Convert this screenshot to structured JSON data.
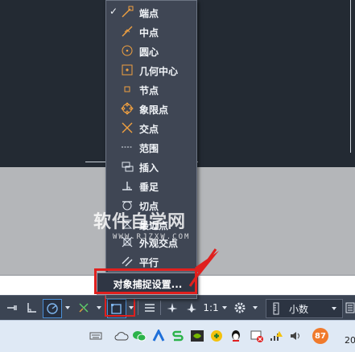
{
  "snap_menu": {
    "items": [
      {
        "label": "端点",
        "icon": "endpoint-icon",
        "checked": true
      },
      {
        "label": "中点",
        "icon": "midpoint-icon",
        "checked": false
      },
      {
        "label": "圆心",
        "icon": "center-icon",
        "checked": false
      },
      {
        "label": "几何中心",
        "icon": "geometric-center-icon",
        "checked": false
      },
      {
        "label": "节点",
        "icon": "node-icon",
        "checked": false
      },
      {
        "label": "象限点",
        "icon": "quadrant-icon",
        "checked": false
      },
      {
        "label": "交点",
        "icon": "intersection-icon",
        "checked": false
      },
      {
        "label": "范围",
        "icon": "extension-icon",
        "checked": false
      },
      {
        "label": "插入",
        "icon": "insertion-icon",
        "checked": false
      },
      {
        "label": "垂足",
        "icon": "perpendicular-icon",
        "checked": false
      },
      {
        "label": "切点",
        "icon": "tangent-icon",
        "checked": false
      },
      {
        "label": "最近点",
        "icon": "nearest-icon",
        "checked": false
      },
      {
        "label": "外观交点",
        "icon": "apparent-intersection-icon",
        "checked": false
      },
      {
        "label": "平行",
        "icon": "parallel-icon",
        "checked": false
      }
    ],
    "check_mark": "✓",
    "settings_label": "对象捕捉设置..."
  },
  "statusbar": {
    "zoom_scale": "1:1",
    "units": "小数"
  },
  "taskbar": {
    "badge_count": "87",
    "clock_partial": "20"
  },
  "watermark": {
    "title": "软件自学网",
    "subtitle": "WWW.RJZXW.COM"
  },
  "colors": {
    "accent_red": "#e0201e",
    "menu_bg": "#3f4654",
    "statusbar_bg": "#3b4453",
    "active_blue": "#4b8fd6"
  }
}
